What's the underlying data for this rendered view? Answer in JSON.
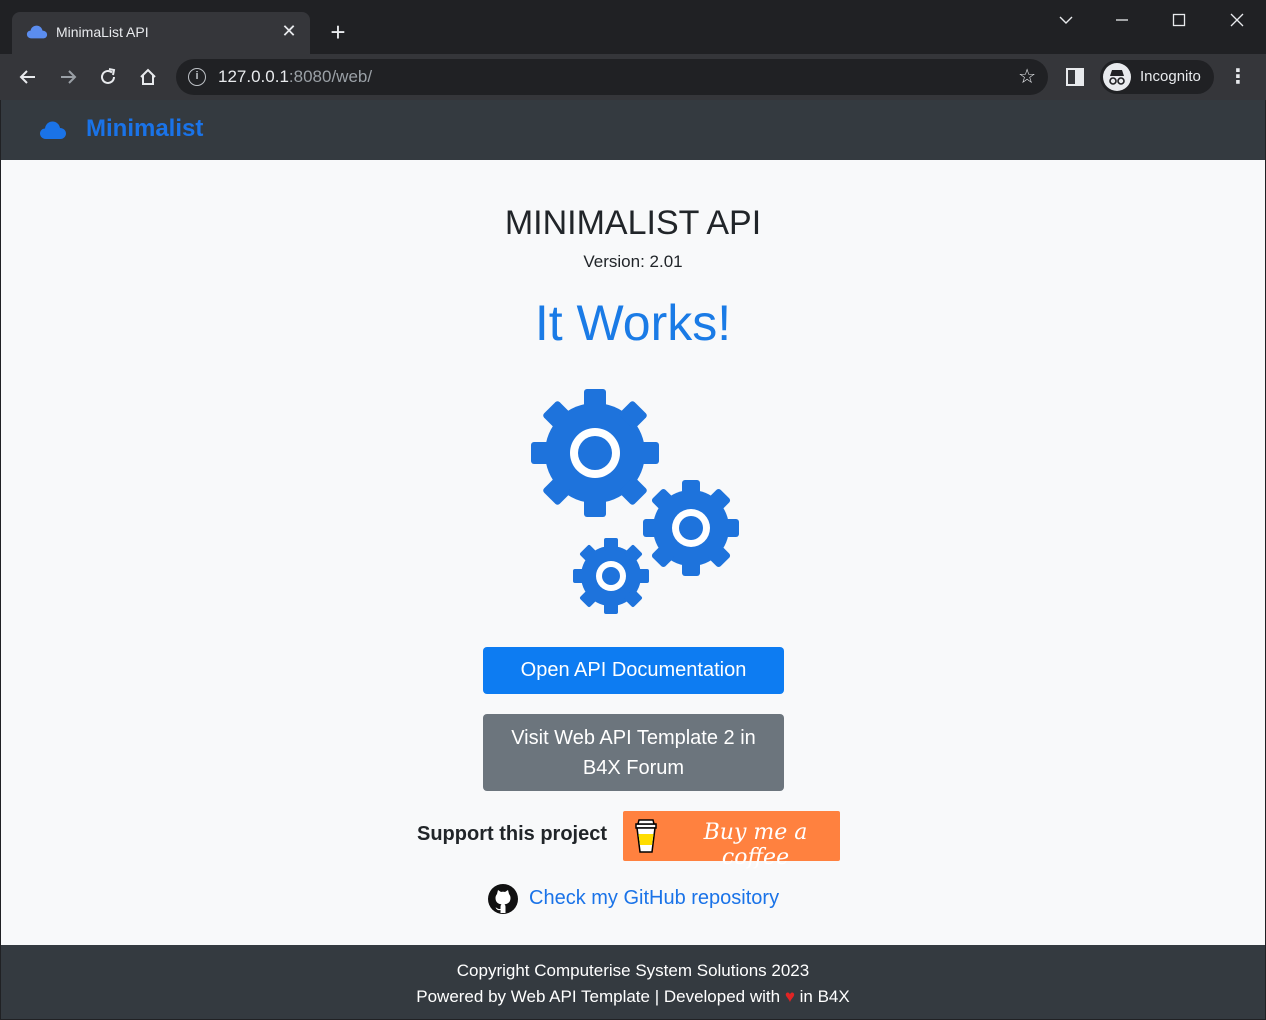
{
  "browser": {
    "tab_title": "MinimaList API",
    "tab_close": "✕",
    "new_tab": "+",
    "url_host": "127.0.0.1",
    "url_rest": ":8080/web/",
    "incognito_label": "Incognito",
    "menu": "⋮"
  },
  "navbar": {
    "brand": "Minimalist",
    "accent": "#1a73e8"
  },
  "main": {
    "title": "MINIMALIST API",
    "version": "Version: 2.01",
    "headline": "It Works!",
    "open_docs_label": "Open API Documentation",
    "forum_label": "Visit Web API Template 2 in B4X Forum",
    "support_label": "Support this project",
    "bmc_label": "Buy me a coffee",
    "github_label": "Check my GitHub repository"
  },
  "footer": {
    "line1": "Copyright Computerise System Solutions 2023",
    "line2_before": "Powered by Web API Template | Developed with",
    "heart": "♥",
    "line2_after": "in B4X"
  },
  "colors": {
    "gear": "#1e73dc",
    "primary": "#0d7cf2",
    "secondary": "#6c757d",
    "bmc": "#ff813f",
    "footer_bg": "#343a40"
  }
}
